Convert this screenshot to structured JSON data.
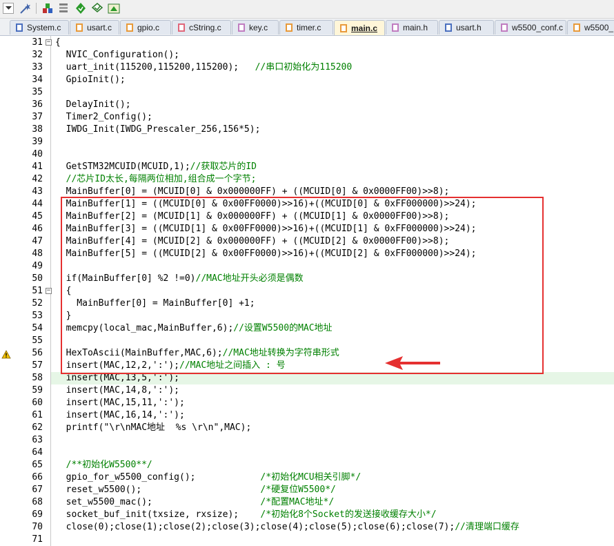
{
  "toolbar": {
    "icons": [
      "dropdown-icon",
      "wizard-icon",
      "build-target-icon",
      "batch-build-icon",
      "download-icon",
      "debug-icon",
      "load-icon"
    ]
  },
  "tabs": [
    {
      "label": "System.c",
      "color": "#4a6fbf"
    },
    {
      "label": "usart.c",
      "color": "#e89a3a"
    },
    {
      "label": "gpio.c",
      "color": "#e89a3a"
    },
    {
      "label": "cString.c",
      "color": "#e0667a"
    },
    {
      "label": "key.c",
      "color": "#c07cc0"
    },
    {
      "label": "timer.c",
      "color": "#e89a3a"
    },
    {
      "label": "main.c",
      "color": "#e89a3a",
      "active": true
    },
    {
      "label": "main.h",
      "color": "#c07cc0"
    },
    {
      "label": "usart.h",
      "color": "#4a6fbf"
    },
    {
      "label": "w5500_conf.c",
      "color": "#c07cc0"
    },
    {
      "label": "w5500_",
      "color": "#e89a3a"
    }
  ],
  "lines": [
    {
      "n": "31",
      "fold": "−",
      "code": "{"
    },
    {
      "n": "32",
      "code": "  NVIC_Configuration();"
    },
    {
      "n": "33",
      "code": "  uart_init(115200,115200,115200);   ",
      "comment": "//串口初始化为115200"
    },
    {
      "n": "34",
      "code": "  GpioInit();"
    },
    {
      "n": "35",
      "code": ""
    },
    {
      "n": "36",
      "code": "  DelayInit();"
    },
    {
      "n": "37",
      "code": "  Timer2_Config();"
    },
    {
      "n": "38",
      "code": "  IWDG_Init(IWDG_Prescaler_256,156*5);"
    },
    {
      "n": "39",
      "code": ""
    },
    {
      "n": "40",
      "code": ""
    },
    {
      "n": "41",
      "code": "  GetSTM32MCUID(MCUID,1);",
      "comment": "//获取芯片的ID"
    },
    {
      "n": "42",
      "code": "  ",
      "comment": "//芯片ID太长,每隔两位相加,组合成一个字节;"
    },
    {
      "n": "43",
      "code": "  MainBuffer[0] = (MCUID[0] & 0x000000FF) + ((MCUID[0] & 0x0000FF00)>>8);"
    },
    {
      "n": "44",
      "code": "  MainBuffer[1] = ((MCUID[0] & 0x00FF0000)>>16)+((MCUID[0] & 0xFF000000)>>24);"
    },
    {
      "n": "45",
      "code": "  MainBuffer[2] = (MCUID[1] & 0x000000FF) + ((MCUID[1] & 0x0000FF00)>>8);"
    },
    {
      "n": "46",
      "code": "  MainBuffer[3] = ((MCUID[1] & 0x00FF0000)>>16)+((MCUID[1] & 0xFF000000)>>24);"
    },
    {
      "n": "47",
      "code": "  MainBuffer[4] = (MCUID[2] & 0x000000FF) + ((MCUID[2] & 0x0000FF00)>>8);"
    },
    {
      "n": "48",
      "code": "  MainBuffer[5] = ((MCUID[2] & 0x00FF0000)>>16)+((MCUID[2] & 0xFF000000)>>24);"
    },
    {
      "n": "49",
      "code": ""
    },
    {
      "n": "50",
      "code": "  if(MainBuffer[0] %2 !=0)",
      "comment": "//MAC地址开头必须是偶数"
    },
    {
      "n": "51",
      "fold": "−",
      "code": "  {"
    },
    {
      "n": "52",
      "code": "    MainBuffer[0] = MainBuffer[0] +1;"
    },
    {
      "n": "53",
      "code": "  }"
    },
    {
      "n": "54",
      "code": "  memcpy(local_mac,MainBuffer,6);",
      "comment": "//设置W5500的MAC地址"
    },
    {
      "n": "55",
      "code": ""
    },
    {
      "n": "56",
      "code": "  HexToAscii(MainBuffer,MAC,6);",
      "comment": "//MAC地址转换为字符串形式"
    },
    {
      "n": "57",
      "code": "  insert(MAC,12,2,':');",
      "comment": "//MAC地址之间插入 : 号"
    },
    {
      "n": "58",
      "code": "  insert(MAC,13,5,':');",
      "highlight": true
    },
    {
      "n": "59",
      "code": "  insert(MAC,14,8,':');"
    },
    {
      "n": "60",
      "code": "  insert(MAC,15,11,':');"
    },
    {
      "n": "61",
      "code": "  insert(MAC,16,14,':');"
    },
    {
      "n": "62",
      "code": "  printf(\"\\r\\nMAC地址  %s \\r\\n\",MAC);"
    },
    {
      "n": "63",
      "code": ""
    },
    {
      "n": "64",
      "code": ""
    },
    {
      "n": "65",
      "code": "  ",
      "comment": "/**初始化W5500**/"
    },
    {
      "n": "66",
      "code": "  gpio_for_w5500_config();            ",
      "comment": "/*初始化MCU相关引脚*/"
    },
    {
      "n": "67",
      "code": "  reset_w5500();                      ",
      "comment": "/*硬复位W5500*/"
    },
    {
      "n": "68",
      "code": "  set_w5500_mac();                    ",
      "comment": "/*配置MAC地址*/"
    },
    {
      "n": "69",
      "code": "  socket_buf_init(txsize, rxsize);    ",
      "comment": "/*初始化8个Socket的发送接收缓存大小*/"
    },
    {
      "n": "70",
      "code": "  close(0);close(1);close(2);close(3);close(4);close(5);close(6);close(7);",
      "comment": "//清理端口缓存"
    },
    {
      "n": "71",
      "code": ""
    }
  ],
  "colors": {
    "comment": "#008000",
    "annotation": "#e53030",
    "current_line": "#e6f6e6"
  }
}
